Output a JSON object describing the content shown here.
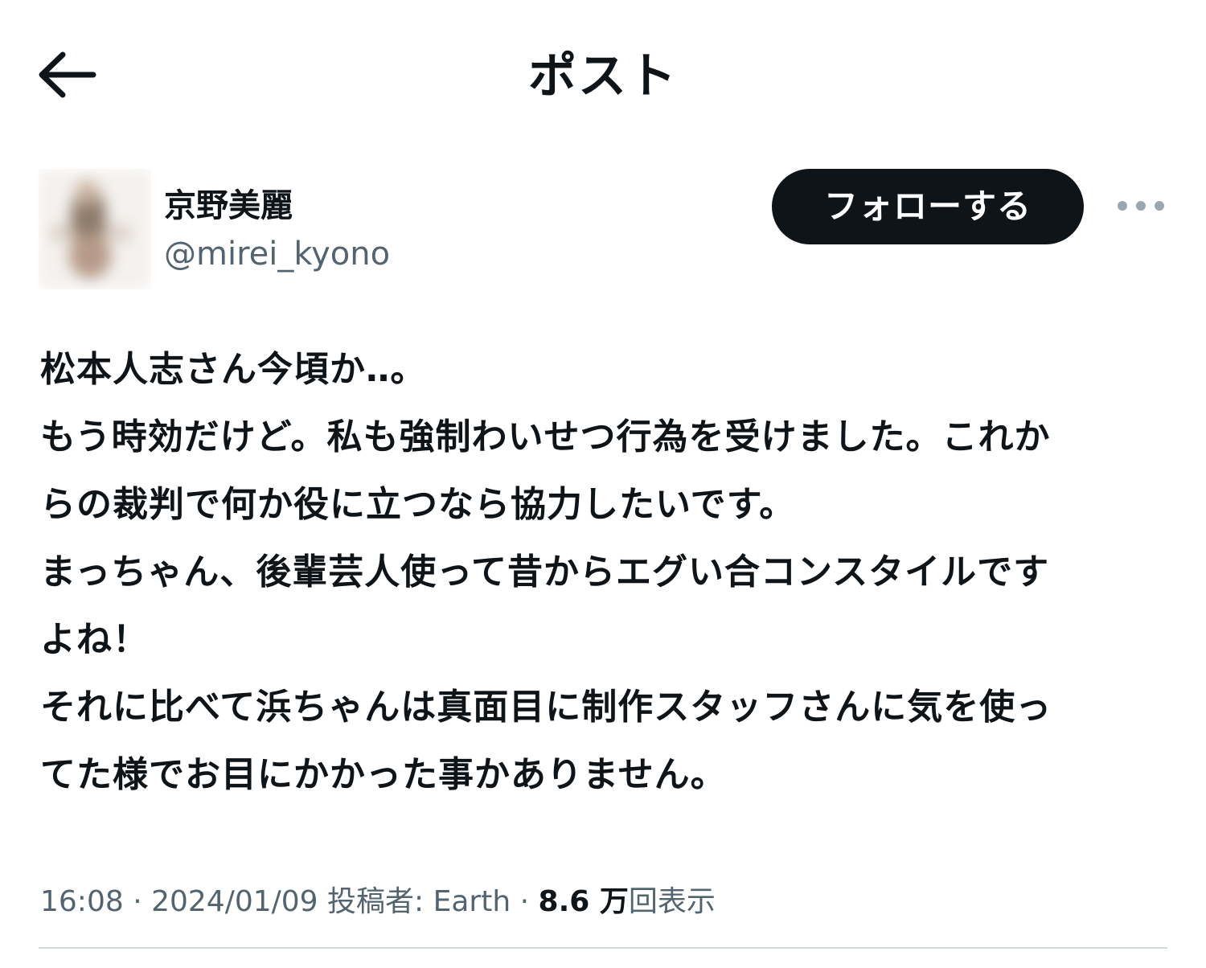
{
  "header": {
    "back_icon": "arrow-left-icon",
    "title": "ポスト"
  },
  "author": {
    "display_name": "京野美麗",
    "handle": "@mirei_kyono",
    "follow_label": "フォローする",
    "more_icon": "more-horizontal-icon"
  },
  "post": {
    "lines": [
      "松本人志さん今頃か‥。",
      "もう時効だけど。私も強制わいせつ行為を受けました。これか",
      "らの裁判で何か役に立つなら協力したいです。",
      "まっちゃん、後輩芸人使って昔からエグい合コンスタイルです",
      "よね！",
      "それに比べて浜ちゃんは真面目に制作スタッフさんに気を使っ",
      "てた様でお目にかかった事かありません。"
    ]
  },
  "meta": {
    "time": "16:08",
    "separator": " · ",
    "date": "2024/01/09",
    "poster_label": "投稿者: Earth",
    "views_count": "8.6 万",
    "views_label": "回表示"
  },
  "colors": {
    "text_primary": "#0f1419",
    "text_secondary": "#536471",
    "follow_bg": "#0f1419",
    "divider": "#cfd9de"
  }
}
